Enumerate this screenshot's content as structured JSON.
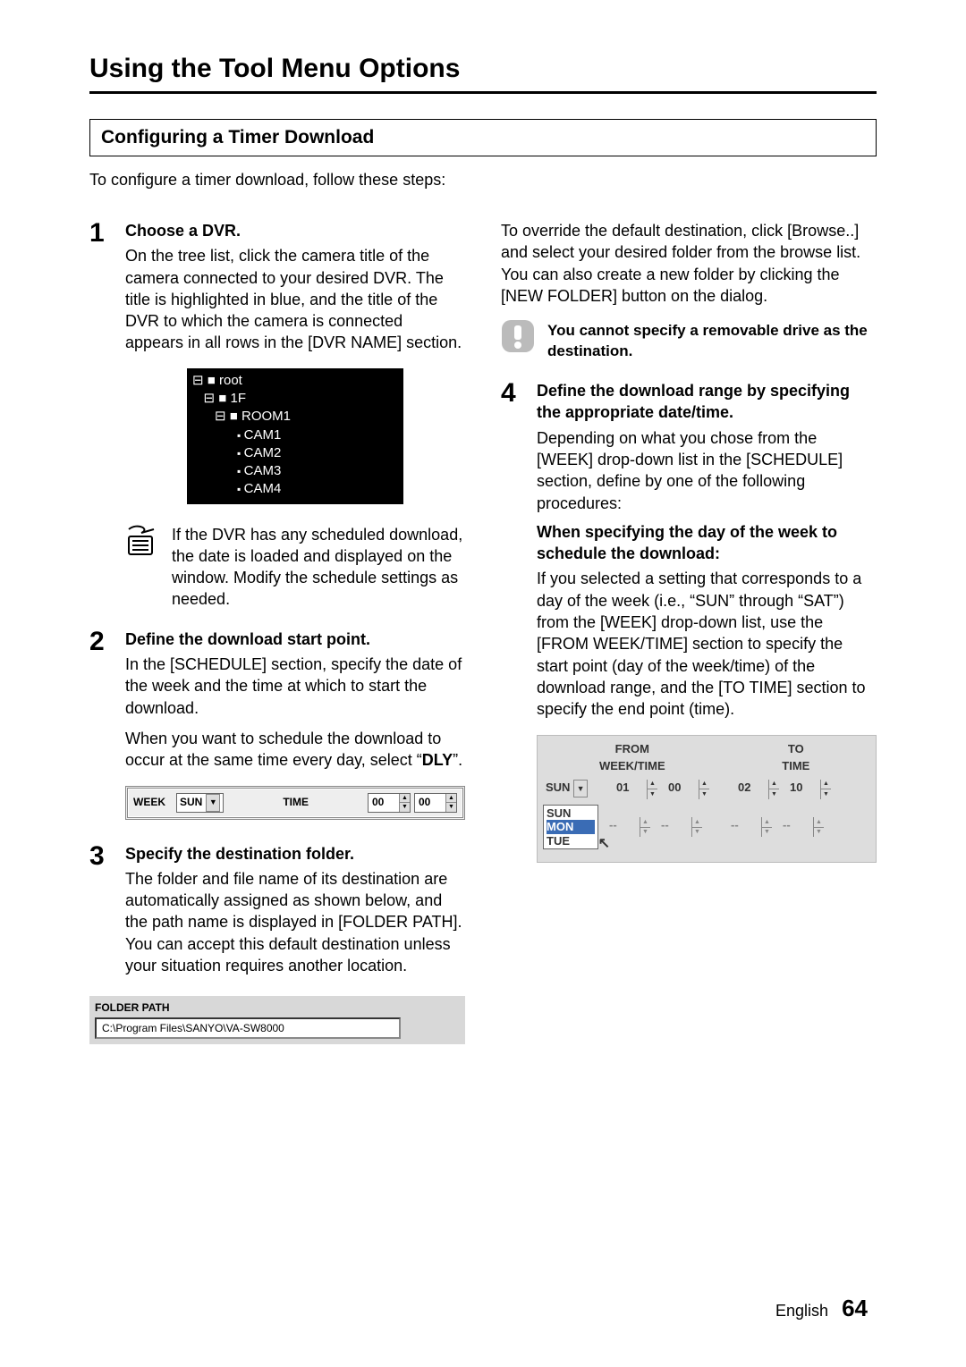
{
  "title": "Using the Tool Menu Options",
  "subtitle": "Configuring a Timer Download",
  "intro": "To configure a timer download, follow these steps:",
  "steps": {
    "s1": {
      "num": "1",
      "heading": "Choose a DVR.",
      "body": "On the tree list, click the camera title of the camera connected to your desired DVR. The title is highlighted in blue, and the title of the DVR to which the camera is connected appears in all rows in the [DVR NAME] section."
    },
    "note1": "If the DVR has any scheduled download, the date is loaded and displayed on the window. Modify the schedule settings as needed.",
    "s2": {
      "num": "2",
      "heading": "Define the download start point.",
      "p1": "In the [SCHEDULE] section, specify the date of the week and the time at which to start the download.",
      "p2_a": "When you want to schedule the download to occur at the same time every day, select “",
      "p2_bold": "DLY",
      "p2_b": "”."
    },
    "s3": {
      "num": "3",
      "heading": "Specify the destination folder.",
      "body": "The folder and file name of its destination are automatically assigned as shown below, and the path name is displayed in [FOLDER PATH]. You can accept this default destination unless your situation requires another location."
    },
    "s3_cont": "To override the default destination, click [Browse..] and select your desired folder from the browse list. You can also create a new folder by clicking the [NEW FOLDER] button on the dialog.",
    "caution": "You cannot specify a removable drive as the destination.",
    "s4": {
      "num": "4",
      "heading": "Define the download range by specifying the appropriate date/time.",
      "p1": "Depending on what you chose from the [WEEK] drop-down list in the [SCHEDULE] section, define by one of the following procedures:",
      "subhead": "When specifying the day of the week to schedule the download:",
      "p2": "If you selected a setting that corresponds to a day of the week (i.e., “SUN” through “SAT”) from the [WEEK] drop-down list, use the [FROM WEEK/TIME] section to specify the start point (day of the week/time) of the download range, and the [TO TIME] section to specify the end point (time)."
    }
  },
  "tree": {
    "root": "root",
    "f1": "1F",
    "room": "ROOM1",
    "cam1": "CAM1",
    "cam2": "CAM2",
    "cam3": "CAM3",
    "cam4": "CAM4"
  },
  "schedule_bar": {
    "week_label": "WEEK",
    "week_value": "SUN",
    "time_label": "TIME",
    "h": "00",
    "m": "00"
  },
  "folderpath": {
    "label": "FOLDER PATH",
    "value": "C:\\Program Files\\SANYO\\VA-SW8000"
  },
  "fromto": {
    "from_label": "FROM",
    "to_label": "TO",
    "weektime_label": "WEEK/TIME",
    "time_label": "TIME",
    "dd_value": "SUN",
    "from_h": "01",
    "from_m": "00",
    "to_h": "02",
    "to_m": "10",
    "opts": {
      "a": "SUN",
      "b": "MON",
      "c": "TUE"
    },
    "dash": "--"
  },
  "footer": {
    "lang": "English",
    "page": "64"
  }
}
